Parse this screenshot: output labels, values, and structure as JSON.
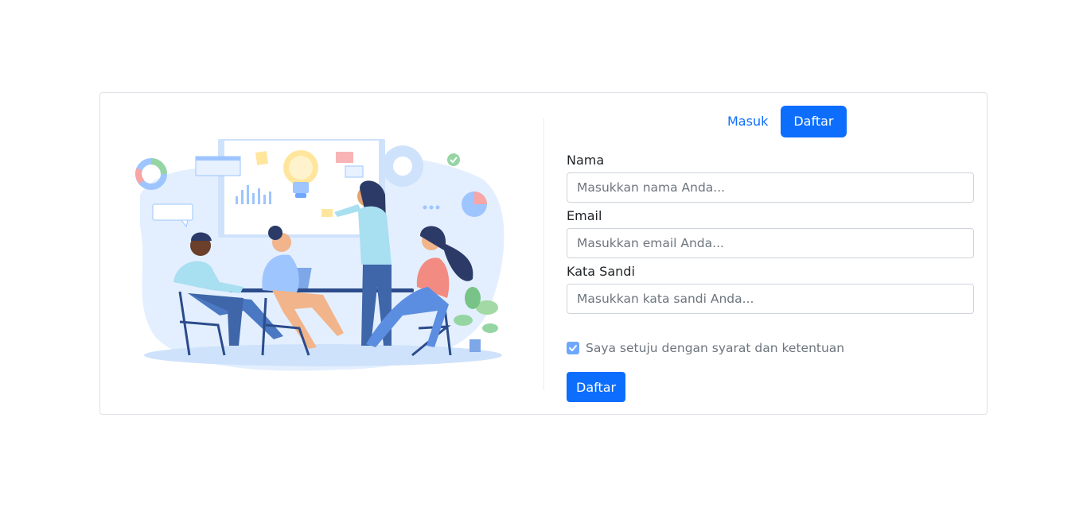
{
  "tabs": {
    "login_label": "Masuk",
    "register_label": "Daftar"
  },
  "form": {
    "name_label": "Nama",
    "name_placeholder": "Masukkan nama Anda...",
    "email_label": "Email",
    "email_placeholder": "Masukkan email Anda...",
    "password_label": "Kata Sandi",
    "password_placeholder": "Masukkan kata sandi Anda...",
    "terms_label": "Saya setuju dengan syarat dan ketentuan",
    "terms_checked": true,
    "submit_label": "Daftar"
  },
  "colors": {
    "primary": "#0d6efd",
    "checkbox": "#6ea8fe",
    "border": "#ced4da"
  }
}
